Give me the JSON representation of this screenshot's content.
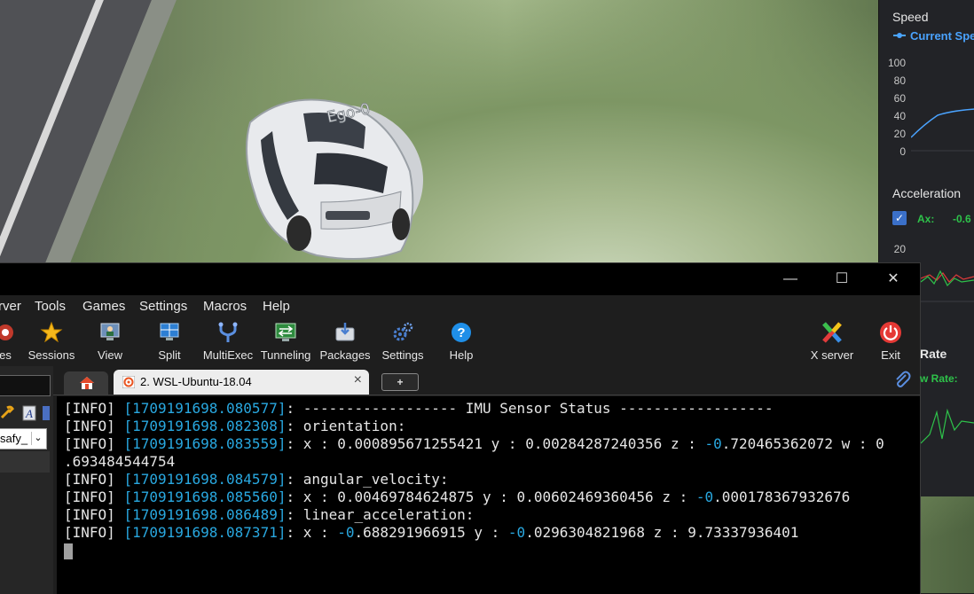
{
  "simulator": {
    "ego_label": "Ego-0"
  },
  "graph_panel": {
    "speed": {
      "title": "Speed",
      "legend": "Current Spe",
      "y_ticks": [
        "100",
        "80",
        "60",
        "40",
        "20",
        "0"
      ]
    },
    "acceleration": {
      "title": "Acceleration",
      "ax_label": "Ax:",
      "ax_value": "-0.6",
      "y_tick": "20",
      "checked": true
    },
    "rate": {
      "title": "Rate",
      "label": "w Rate:"
    },
    "colors": {
      "speed_line": "#4aa3ff",
      "accel_green": "#2ec24a",
      "accel_red": "#e03a3a"
    }
  },
  "window": {
    "controls": {
      "minimize": "—",
      "maximize": "☐",
      "close": "✕"
    },
    "menu": [
      "rver",
      "Tools",
      "Games",
      "Settings",
      "Macros",
      "Help"
    ],
    "toolbar": [
      {
        "label": "es",
        "icon": "generic-icon"
      },
      {
        "label": "Sessions",
        "icon": "star-icon"
      },
      {
        "label": "View",
        "icon": "monitor-user-icon"
      },
      {
        "label": "Split",
        "icon": "split-screen-icon"
      },
      {
        "label": "MultiExec",
        "icon": "fork-icon"
      },
      {
        "label": "Tunneling",
        "icon": "tunnel-icon"
      },
      {
        "label": "Packages",
        "icon": "package-icon"
      },
      {
        "label": "Settings",
        "icon": "gears-icon"
      },
      {
        "label": "Help",
        "icon": "help-icon"
      },
      {
        "label": "X server",
        "icon": "x-server-icon"
      },
      {
        "label": "Exit",
        "icon": "power-icon"
      }
    ],
    "left_panel": {
      "user_select_value": "safy_"
    },
    "tabs": {
      "session_label": "2. WSL-Ubuntu-18.04",
      "close": "×",
      "new_tab": "+"
    }
  },
  "terminal": {
    "lines": [
      {
        "tag": "[INFO]",
        "ts": "[1709191698.080577]",
        "text": ": ------------------ IMU Sensor Status ------------------"
      },
      {
        "tag": "[INFO]",
        "ts": "[1709191698.082308]",
        "text": ": orientation:"
      },
      {
        "tag": "[INFO]",
        "ts": "[1709191698.083559]",
        "text_a": ": x : 0.000895671255421 y : 0.00284287240356 z : ",
        "neg": "-0",
        "text_b": ".720465362072 w : 0"
      },
      {
        "text": ".693484544754"
      },
      {
        "tag": "[INFO]",
        "ts": "[1709191698.084579]",
        "text": ": angular_velocity:"
      },
      {
        "tag": "[INFO]",
        "ts": "[1709191698.085560]",
        "text_a": ": x : 0.00469784624875 y : 0.00602469360456 z : ",
        "neg": "-0",
        "text_b": ".000178367932676"
      },
      {
        "tag": "[INFO]",
        "ts": "[1709191698.086489]",
        "text": ": linear_acceleration:"
      },
      {
        "tag": "[INFO]",
        "ts": "[1709191698.087371]",
        "text_a": ": x : ",
        "neg": "-0",
        "text_b": ".688291966915 y : ",
        "neg2": "-0",
        "text_c": ".0296304821968 z : 9.73337936401"
      }
    ]
  }
}
